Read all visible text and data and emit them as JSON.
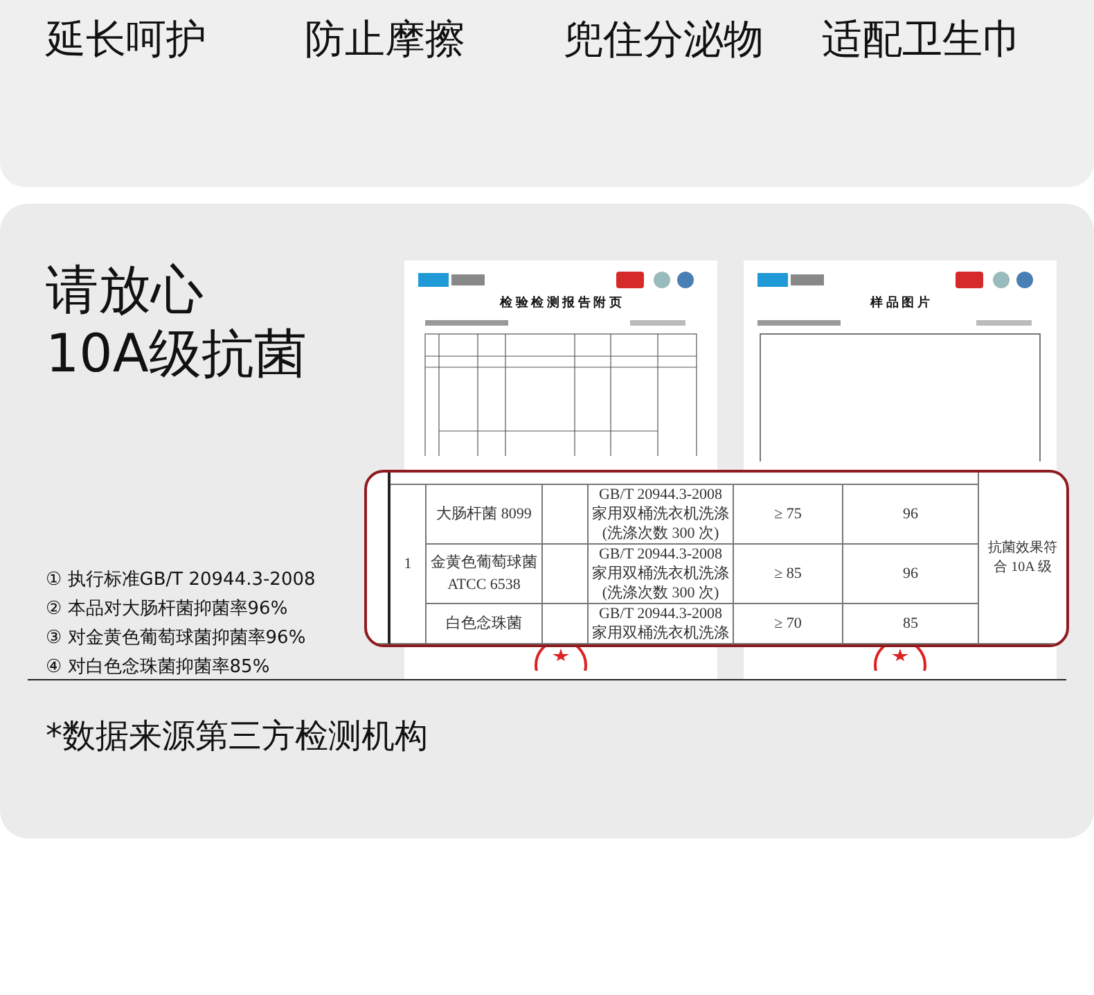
{
  "features": [
    "延长呵护",
    "防止摩擦",
    "兜住分泌物",
    "适配卫生巾"
  ],
  "heading": [
    "请放心",
    "10A级抗菌"
  ],
  "notes": [
    "① 执行标准GB/T 20944.3-2008",
    "② 本品对大肠杆菌抑菌率96%",
    "③ 对金黄色葡萄球菌抑菌率96%",
    "④ 对白色念珠菌抑菌率85%"
  ],
  "documents": [
    {
      "kind": "table",
      "title": "检 验 检 测 报 告 附 页"
    },
    {
      "kind": "photo",
      "title": "样 品 图 片"
    }
  ],
  "result_table": {
    "index": "1",
    "conclusion": "抗菌效果符合 10A 级",
    "rows": [
      {
        "organism": [
          "大肠杆菌 8099"
        ],
        "method": [
          "GB/T 20944.3-2008",
          "家用双桶洗衣机洗涤",
          "(洗涤次数 300 次)"
        ],
        "requirement": "≥ 75",
        "result": "96"
      },
      {
        "organism": [
          "金黄色葡萄球菌",
          "ATCC 6538"
        ],
        "method": [
          "GB/T 20944.3-2008",
          "家用双桶洗衣机洗涤",
          "(洗涤次数 300 次)"
        ],
        "requirement": "≥ 85",
        "result": "96"
      },
      {
        "organism": [
          "白色念珠菌"
        ],
        "method": [
          "GB/T 20944.3-2008",
          "家用双桶洗衣机洗涤"
        ],
        "requirement": "≥ 70",
        "result": "85"
      }
    ]
  },
  "footnote": "*数据来源第三方检测机构"
}
